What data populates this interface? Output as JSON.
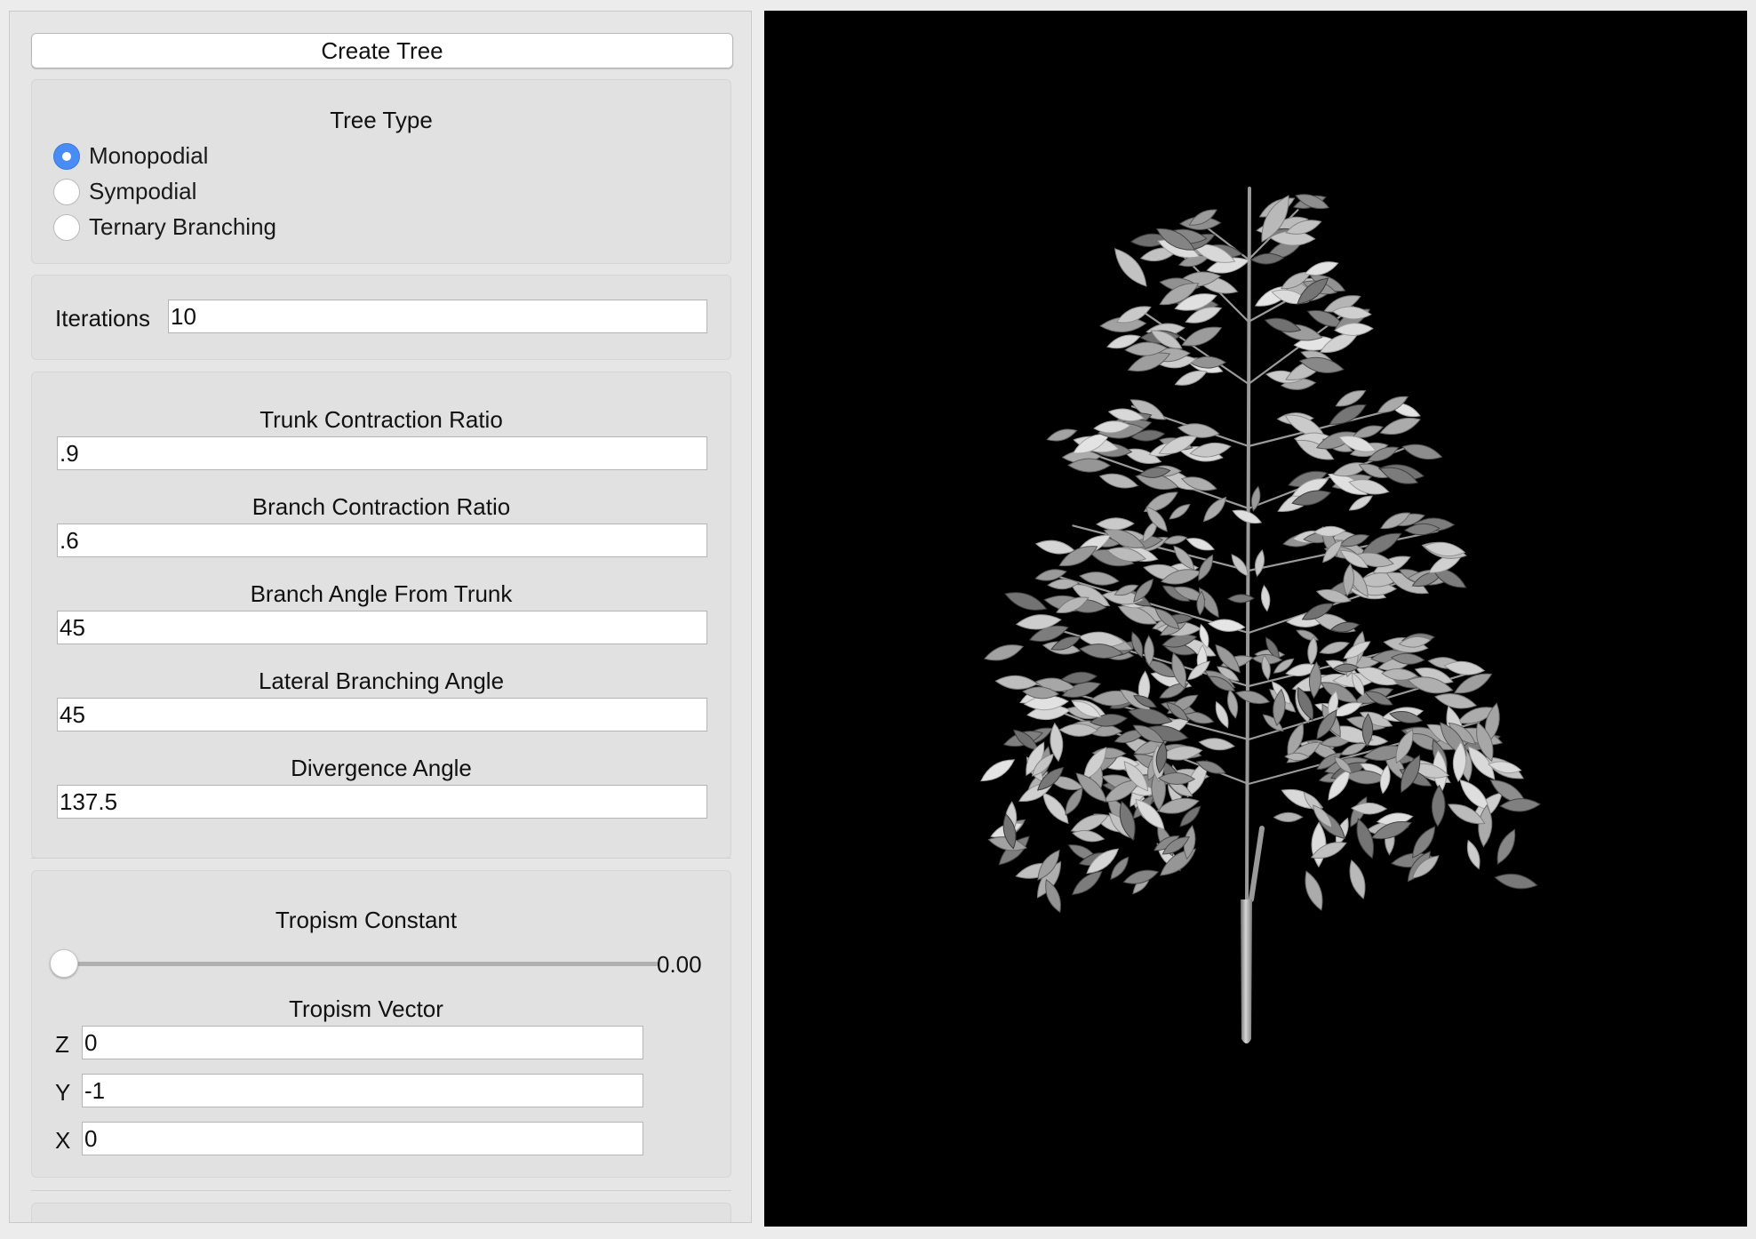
{
  "panel": {
    "create_button": "Create Tree",
    "tree_type": {
      "title": "Tree Type",
      "options": [
        "Monopodial",
        "Sympodial",
        "Ternary Branching"
      ],
      "selected": "Monopodial"
    },
    "iterations": {
      "label": "Iterations",
      "value": "10"
    },
    "ratios": {
      "trunk_contraction": {
        "label": "Trunk Contraction Ratio",
        "value": ".9"
      },
      "branch_contraction": {
        "label": "Branch Contraction Ratio",
        "value": ".6"
      },
      "branch_angle": {
        "label": "Branch Angle From Trunk",
        "value": "45"
      },
      "lateral_angle": {
        "label": "Lateral Branching Angle",
        "value": "45"
      },
      "divergence_angle": {
        "label": "Divergence Angle",
        "value": "137.5"
      }
    },
    "tropism": {
      "constant_label": "Tropism Constant",
      "constant_value": "0.00",
      "constant_fraction": 0,
      "vector_label": "Tropism Vector",
      "z": {
        "label": "Z",
        "value": "0"
      },
      "y": {
        "label": "Y",
        "value": "-1"
      },
      "x": {
        "label": "X",
        "value": "0"
      }
    }
  },
  "viewport": {
    "background": "#000000",
    "content": "3d-tree-render"
  }
}
